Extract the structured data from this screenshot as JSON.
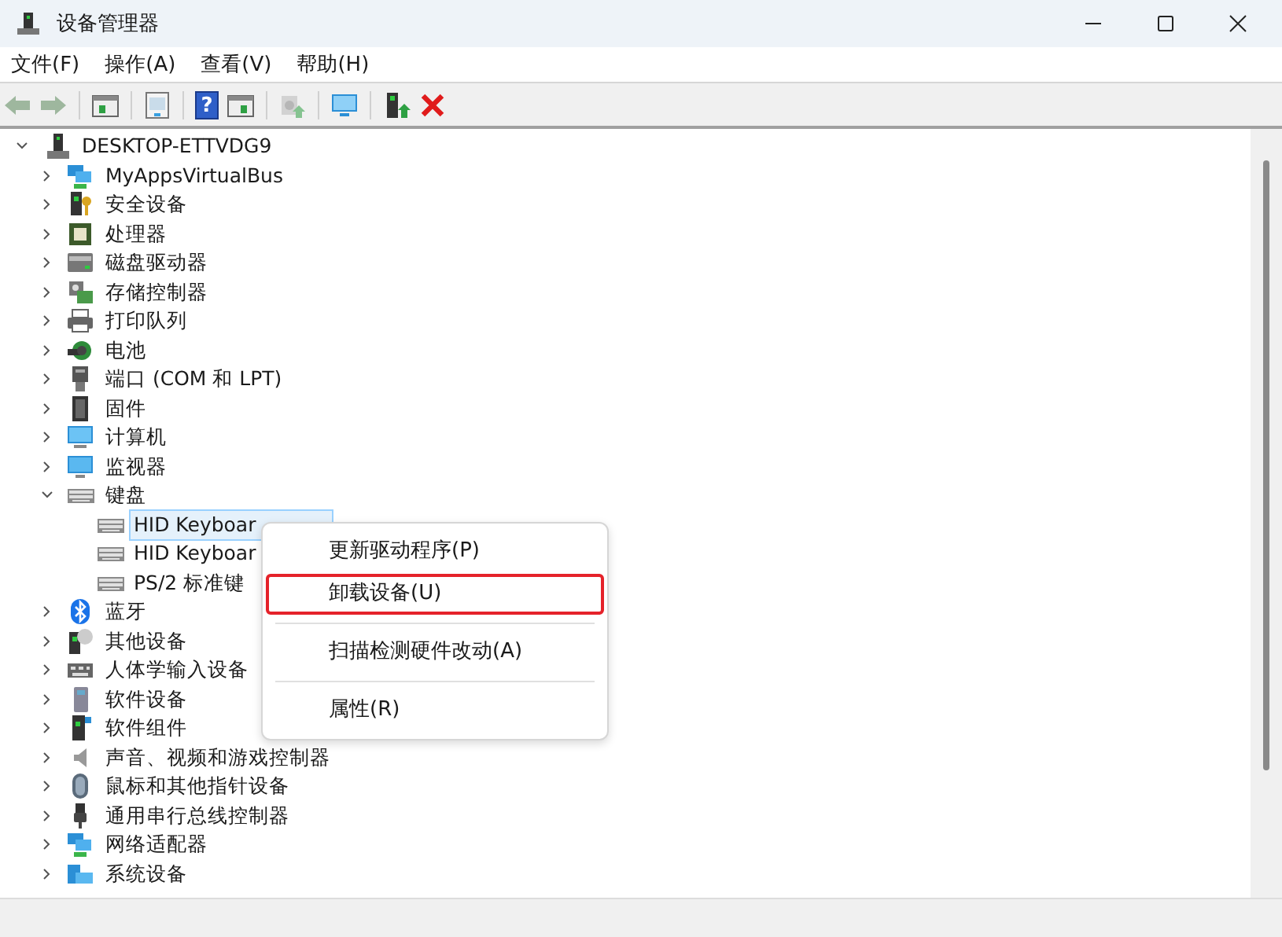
{
  "window": {
    "title": "设备管理器"
  },
  "menu": [
    {
      "label": "文件(F)"
    },
    {
      "label": "操作(A)"
    },
    {
      "label": "查看(V)"
    },
    {
      "label": "帮助(H)"
    }
  ],
  "toolbar": [
    {
      "kind": "back",
      "disabled": true
    },
    {
      "kind": "forward",
      "disabled": true
    },
    {
      "kind": "sep"
    },
    {
      "kind": "console"
    },
    {
      "kind": "sep"
    },
    {
      "kind": "properties"
    },
    {
      "kind": "sep"
    },
    {
      "kind": "help",
      "text": "?"
    },
    {
      "kind": "action-pane"
    },
    {
      "kind": "sep"
    },
    {
      "kind": "scan",
      "disabled": true
    },
    {
      "kind": "sep"
    },
    {
      "kind": "monitor"
    },
    {
      "kind": "sep"
    },
    {
      "kind": "enable"
    },
    {
      "kind": "uninstall"
    }
  ],
  "tree": {
    "label": "DESKTOP-ETTVDG9",
    "expanded": true,
    "children": [
      {
        "label": "MyAppsVirtualBus",
        "kind": "network",
        "expanded": false
      },
      {
        "label": "安全设备",
        "kind": "security",
        "expanded": false
      },
      {
        "label": "处理器",
        "kind": "cpu",
        "expanded": false
      },
      {
        "label": "磁盘驱动器",
        "kind": "disk",
        "expanded": false
      },
      {
        "label": "存储控制器",
        "kind": "storage",
        "expanded": false
      },
      {
        "label": "打印队列",
        "kind": "printer",
        "expanded": false
      },
      {
        "label": "电池",
        "kind": "battery",
        "expanded": false
      },
      {
        "label": "端口 (COM 和 LPT)",
        "kind": "port",
        "expanded": false
      },
      {
        "label": "固件",
        "kind": "firmware",
        "expanded": false
      },
      {
        "label": "计算机",
        "kind": "computer",
        "expanded": false
      },
      {
        "label": "监视器",
        "kind": "monitor",
        "expanded": false
      },
      {
        "label": "键盘",
        "kind": "keyboard",
        "expanded": true,
        "children": [
          {
            "label": "HID Keyboar",
            "kind": "keyboard",
            "selected": true
          },
          {
            "label": "HID Keyboar",
            "kind": "keyboard",
            "selected": false
          },
          {
            "label": "PS/2 标准键",
            "kind": "keyboard",
            "selected": false
          }
        ]
      },
      {
        "label": "蓝牙",
        "kind": "bluetooth",
        "expanded": false
      },
      {
        "label": "其他设备",
        "kind": "unknown",
        "expanded": false
      },
      {
        "label": "人体学输入设备",
        "kind": "hid",
        "expanded": false
      },
      {
        "label": "软件设备",
        "kind": "software",
        "expanded": false
      },
      {
        "label": "软件组件",
        "kind": "component",
        "expanded": false
      },
      {
        "label": "声音、视频和游戏控制器",
        "kind": "audio",
        "expanded": false
      },
      {
        "label": "鼠标和其他指针设备",
        "kind": "mouse",
        "expanded": false
      },
      {
        "label": "通用串行总线控制器",
        "kind": "usb",
        "expanded": false
      },
      {
        "label": "网络适配器",
        "kind": "network",
        "expanded": false
      },
      {
        "label": "系统设备",
        "kind": "system",
        "expanded": false
      }
    ]
  },
  "context_menu": [
    {
      "kind": "item",
      "label": "更新驱动程序(P)",
      "focused": false
    },
    {
      "kind": "item",
      "label": "卸载设备(U)",
      "focused": true
    },
    {
      "kind": "separator"
    },
    {
      "kind": "item",
      "label": "扫描检测硬件改动(A)",
      "focused": false
    },
    {
      "kind": "separator"
    },
    {
      "kind": "item",
      "label": "属性(R)",
      "focused": false
    }
  ]
}
